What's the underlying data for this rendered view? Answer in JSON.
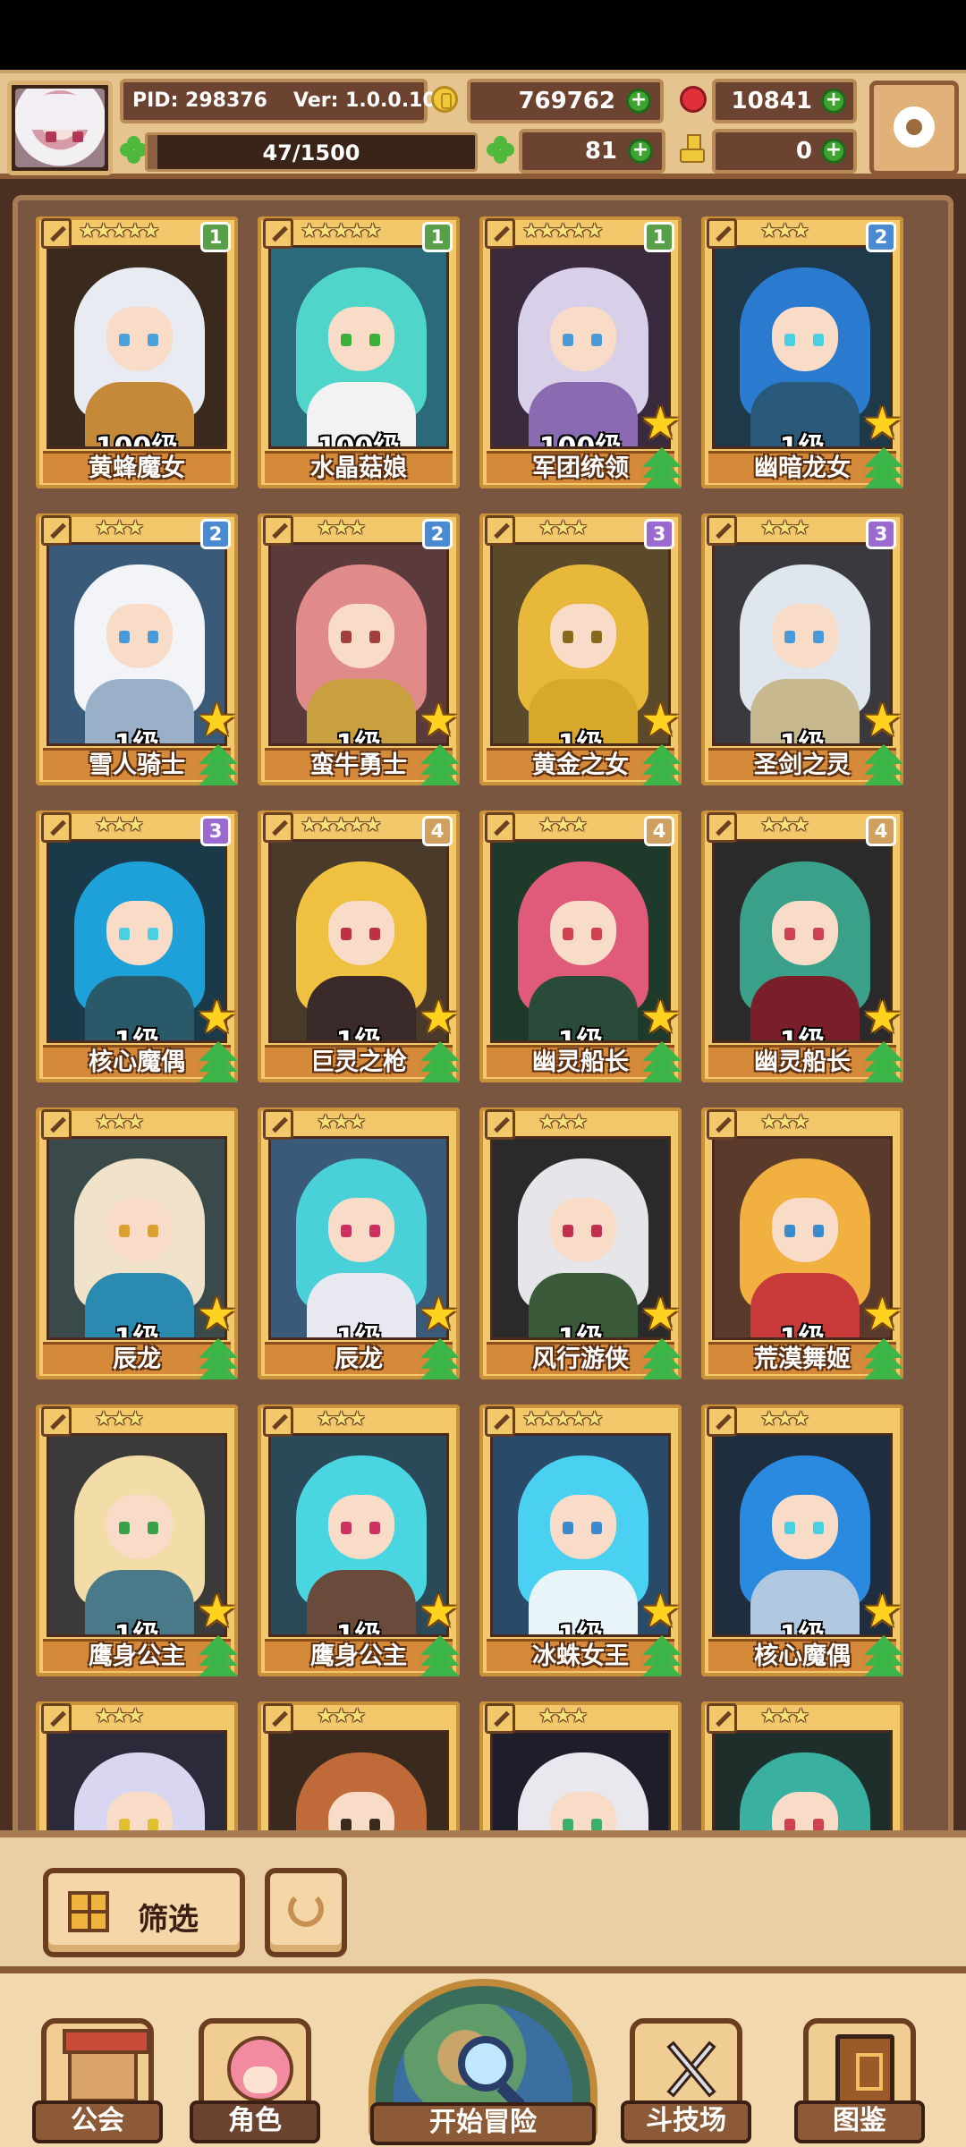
{
  "header": {
    "pid_text": "PID: 298376",
    "version_text": "Ver: 1.0.0.10",
    "xp_text": "47/1500",
    "xp_progress": 0.031,
    "coins": "769762",
    "gems": "10841",
    "clovers": "81",
    "boots": "0",
    "icons": {
      "avatar": "player-avatar",
      "coin": "coin-icon",
      "gem": "red-gem-icon",
      "clover": "clover-icon",
      "boot": "boot-icon",
      "settings": "gear-icon"
    }
  },
  "cards": [
    {
      "name": "黄蜂魔女",
      "level": "100级",
      "stars": 5,
      "badge": "1",
      "badge_color": "#5aa04a",
      "upgrade": false,
      "hair": "#e8ecf2",
      "bg": "#3a2a1e",
      "body": "#c48a3a",
      "eye": "#4aa0d8"
    },
    {
      "name": "水晶菇娘",
      "level": "100级",
      "stars": 5,
      "badge": "1",
      "badge_color": "#5aa04a",
      "upgrade": false,
      "hair": "#4fd6c8",
      "bg": "#2a6a7a",
      "body": "#f2f2f2",
      "eye": "#3ab03a"
    },
    {
      "name": "军团统领",
      "level": "100级",
      "stars": 5,
      "badge": "1",
      "badge_color": "#5aa04a",
      "upgrade": true,
      "hair": "#d8d0e8",
      "bg": "#3a2a3e",
      "body": "#8a6ab0",
      "eye": "#4a9ad8"
    },
    {
      "name": "幽暗龙女",
      "level": "1级",
      "stars": 3,
      "badge": "2",
      "badge_color": "#4a8ad0",
      "upgrade": true,
      "hair": "#2a7ad0",
      "bg": "#1e3a4a",
      "body": "#2a5a7a",
      "eye": "#4ad0e0"
    },
    {
      "name": "雪人骑士",
      "level": "1级",
      "stars": 3,
      "badge": "2",
      "badge_color": "#4a8ad0",
      "upgrade": true,
      "hair": "#f2f4f8",
      "bg": "#3a5a7a",
      "body": "#9ab0c8",
      "eye": "#4a9ad8"
    },
    {
      "name": "蛮牛勇士",
      "level": "1级",
      "stars": 3,
      "badge": "2",
      "badge_color": "#4a8ad0",
      "upgrade": true,
      "hair": "#e08a8a",
      "bg": "#5a3a3a",
      "body": "#c8a040",
      "eye": "#a04040"
    },
    {
      "name": "黄金之女",
      "level": "1级",
      "stars": 3,
      "badge": "3",
      "badge_color": "#9a6ad0",
      "upgrade": true,
      "hair": "#e8b83a",
      "bg": "#5a4a2a",
      "body": "#d8a82a",
      "eye": "#8a6a1a"
    },
    {
      "name": "圣剑之灵",
      "level": "1级",
      "stars": 3,
      "badge": "3",
      "badge_color": "#9a6ad0",
      "upgrade": true,
      "hair": "#dfe6ee",
      "bg": "#3a3a3e",
      "body": "#c8b890",
      "eye": "#4a9ad8"
    },
    {
      "name": "核心魔偶",
      "level": "1级",
      "stars": 3,
      "badge": "3",
      "badge_color": "#9a6ad0",
      "upgrade": true,
      "hair": "#1ea0d8",
      "bg": "#1a3a4a",
      "body": "#2a5a6a",
      "eye": "#4ad0e0"
    },
    {
      "name": "巨灵之枪",
      "level": "1级",
      "stars": 5,
      "badge": "4",
      "badge_color": "#d0a060",
      "upgrade": true,
      "hair": "#f0c040",
      "bg": "#4a3a2a",
      "body": "#3a2a2a",
      "eye": "#c03040"
    },
    {
      "name": "幽灵船长",
      "level": "1级",
      "stars": 3,
      "badge": "4",
      "badge_color": "#d0a060",
      "upgrade": true,
      "hair": "#e05a7a",
      "bg": "#1e3a2a",
      "body": "#2a4a3a",
      "eye": "#d04050"
    },
    {
      "name": "幽灵船长",
      "level": "1级",
      "stars": 3,
      "badge": "4",
      "badge_color": "#d0a060",
      "upgrade": true,
      "hair": "#3aa08a",
      "bg": "#2a2a2a",
      "body": "#7a1e2a",
      "eye": "#d04050"
    },
    {
      "name": "辰龙",
      "level": "1级",
      "stars": 3,
      "badge": "",
      "badge_color": "",
      "upgrade": true,
      "hair": "#efe2c8",
      "bg": "#3a4a4a",
      "body": "#2a8ab0",
      "eye": "#e0a030"
    },
    {
      "name": "辰龙",
      "level": "1级",
      "stars": 3,
      "badge": "",
      "badge_color": "",
      "upgrade": true,
      "hair": "#4ad0d8",
      "bg": "#3a5a7a",
      "body": "#e8e8f0",
      "eye": "#d03060"
    },
    {
      "name": "风行游侠",
      "level": "1级",
      "stars": 3,
      "badge": "",
      "badge_color": "",
      "upgrade": true,
      "hair": "#e6e6ea",
      "bg": "#2a2a2a",
      "body": "#3a5a3a",
      "eye": "#c03050"
    },
    {
      "name": "荒漠舞姬",
      "level": "1级",
      "stars": 3,
      "badge": "",
      "badge_color": "",
      "upgrade": true,
      "hair": "#f2b040",
      "bg": "#5a3a2a",
      "body": "#c83a3a",
      "eye": "#3a8ad0"
    },
    {
      "name": "鹰身公主",
      "level": "1级",
      "stars": 3,
      "badge": "",
      "badge_color": "",
      "upgrade": true,
      "hair": "#f2dca8",
      "bg": "#3a3a3a",
      "body": "#4a7a8a",
      "eye": "#3aa04a"
    },
    {
      "name": "鹰身公主",
      "level": "1级",
      "stars": 3,
      "badge": "",
      "badge_color": "",
      "upgrade": true,
      "hair": "#4ad6e0",
      "bg": "#2a4a5a",
      "body": "#6a4a3a",
      "eye": "#d03060"
    },
    {
      "name": "冰蛛女王",
      "level": "1级",
      "stars": 5,
      "badge": "",
      "badge_color": "",
      "upgrade": true,
      "hair": "#4ad0f0",
      "bg": "#2a4a6a",
      "body": "#e8f4f8",
      "eye": "#3a8ad0"
    },
    {
      "name": "核心魔偶",
      "level": "1级",
      "stars": 3,
      "badge": "",
      "badge_color": "",
      "upgrade": true,
      "hair": "#2a8ae0",
      "bg": "#1e2e3e",
      "body": "#b0c8e0",
      "eye": "#4ad0e0"
    },
    {
      "name": "",
      "level": "",
      "stars": 3,
      "badge": "",
      "badge_color": "",
      "upgrade": false,
      "hair": "#d8d6f0",
      "bg": "#2a2a3a",
      "body": "#3a2a3a",
      "eye": "#e0c030"
    },
    {
      "name": "",
      "level": "",
      "stars": 3,
      "badge": "",
      "badge_color": "",
      "upgrade": false,
      "hair": "#c06a3a",
      "bg": "#3a2a1e",
      "body": "#c06a3a",
      "eye": "#3a2a1e"
    },
    {
      "name": "",
      "level": "",
      "stars": 3,
      "badge": "",
      "badge_color": "",
      "upgrade": false,
      "hair": "#e8e8ee",
      "bg": "#1e1e2a",
      "body": "#2a2a3a",
      "eye": "#3ab06a"
    },
    {
      "name": "",
      "level": "",
      "stars": 3,
      "badge": "",
      "badge_color": "",
      "upgrade": false,
      "hair": "#3ab0a0",
      "bg": "#1e2e2a",
      "body": "#2a3a3a",
      "eye": "#d04050"
    }
  ],
  "filter_bar": {
    "filter_label": "筛选",
    "icons": {
      "filter": "grid-icon",
      "refresh": "refresh-icon"
    }
  },
  "nav": {
    "guild": "公会",
    "character": "角色",
    "adventure": "开始冒险",
    "arena": "斗技场",
    "codex": "图鉴",
    "active": "character",
    "icons": {
      "guild": "guild-hall-icon",
      "character": "character-portrait-icon",
      "adventure": "magnifier-map-icon",
      "arena": "crossed-swords-icon",
      "codex": "book-icon"
    }
  }
}
